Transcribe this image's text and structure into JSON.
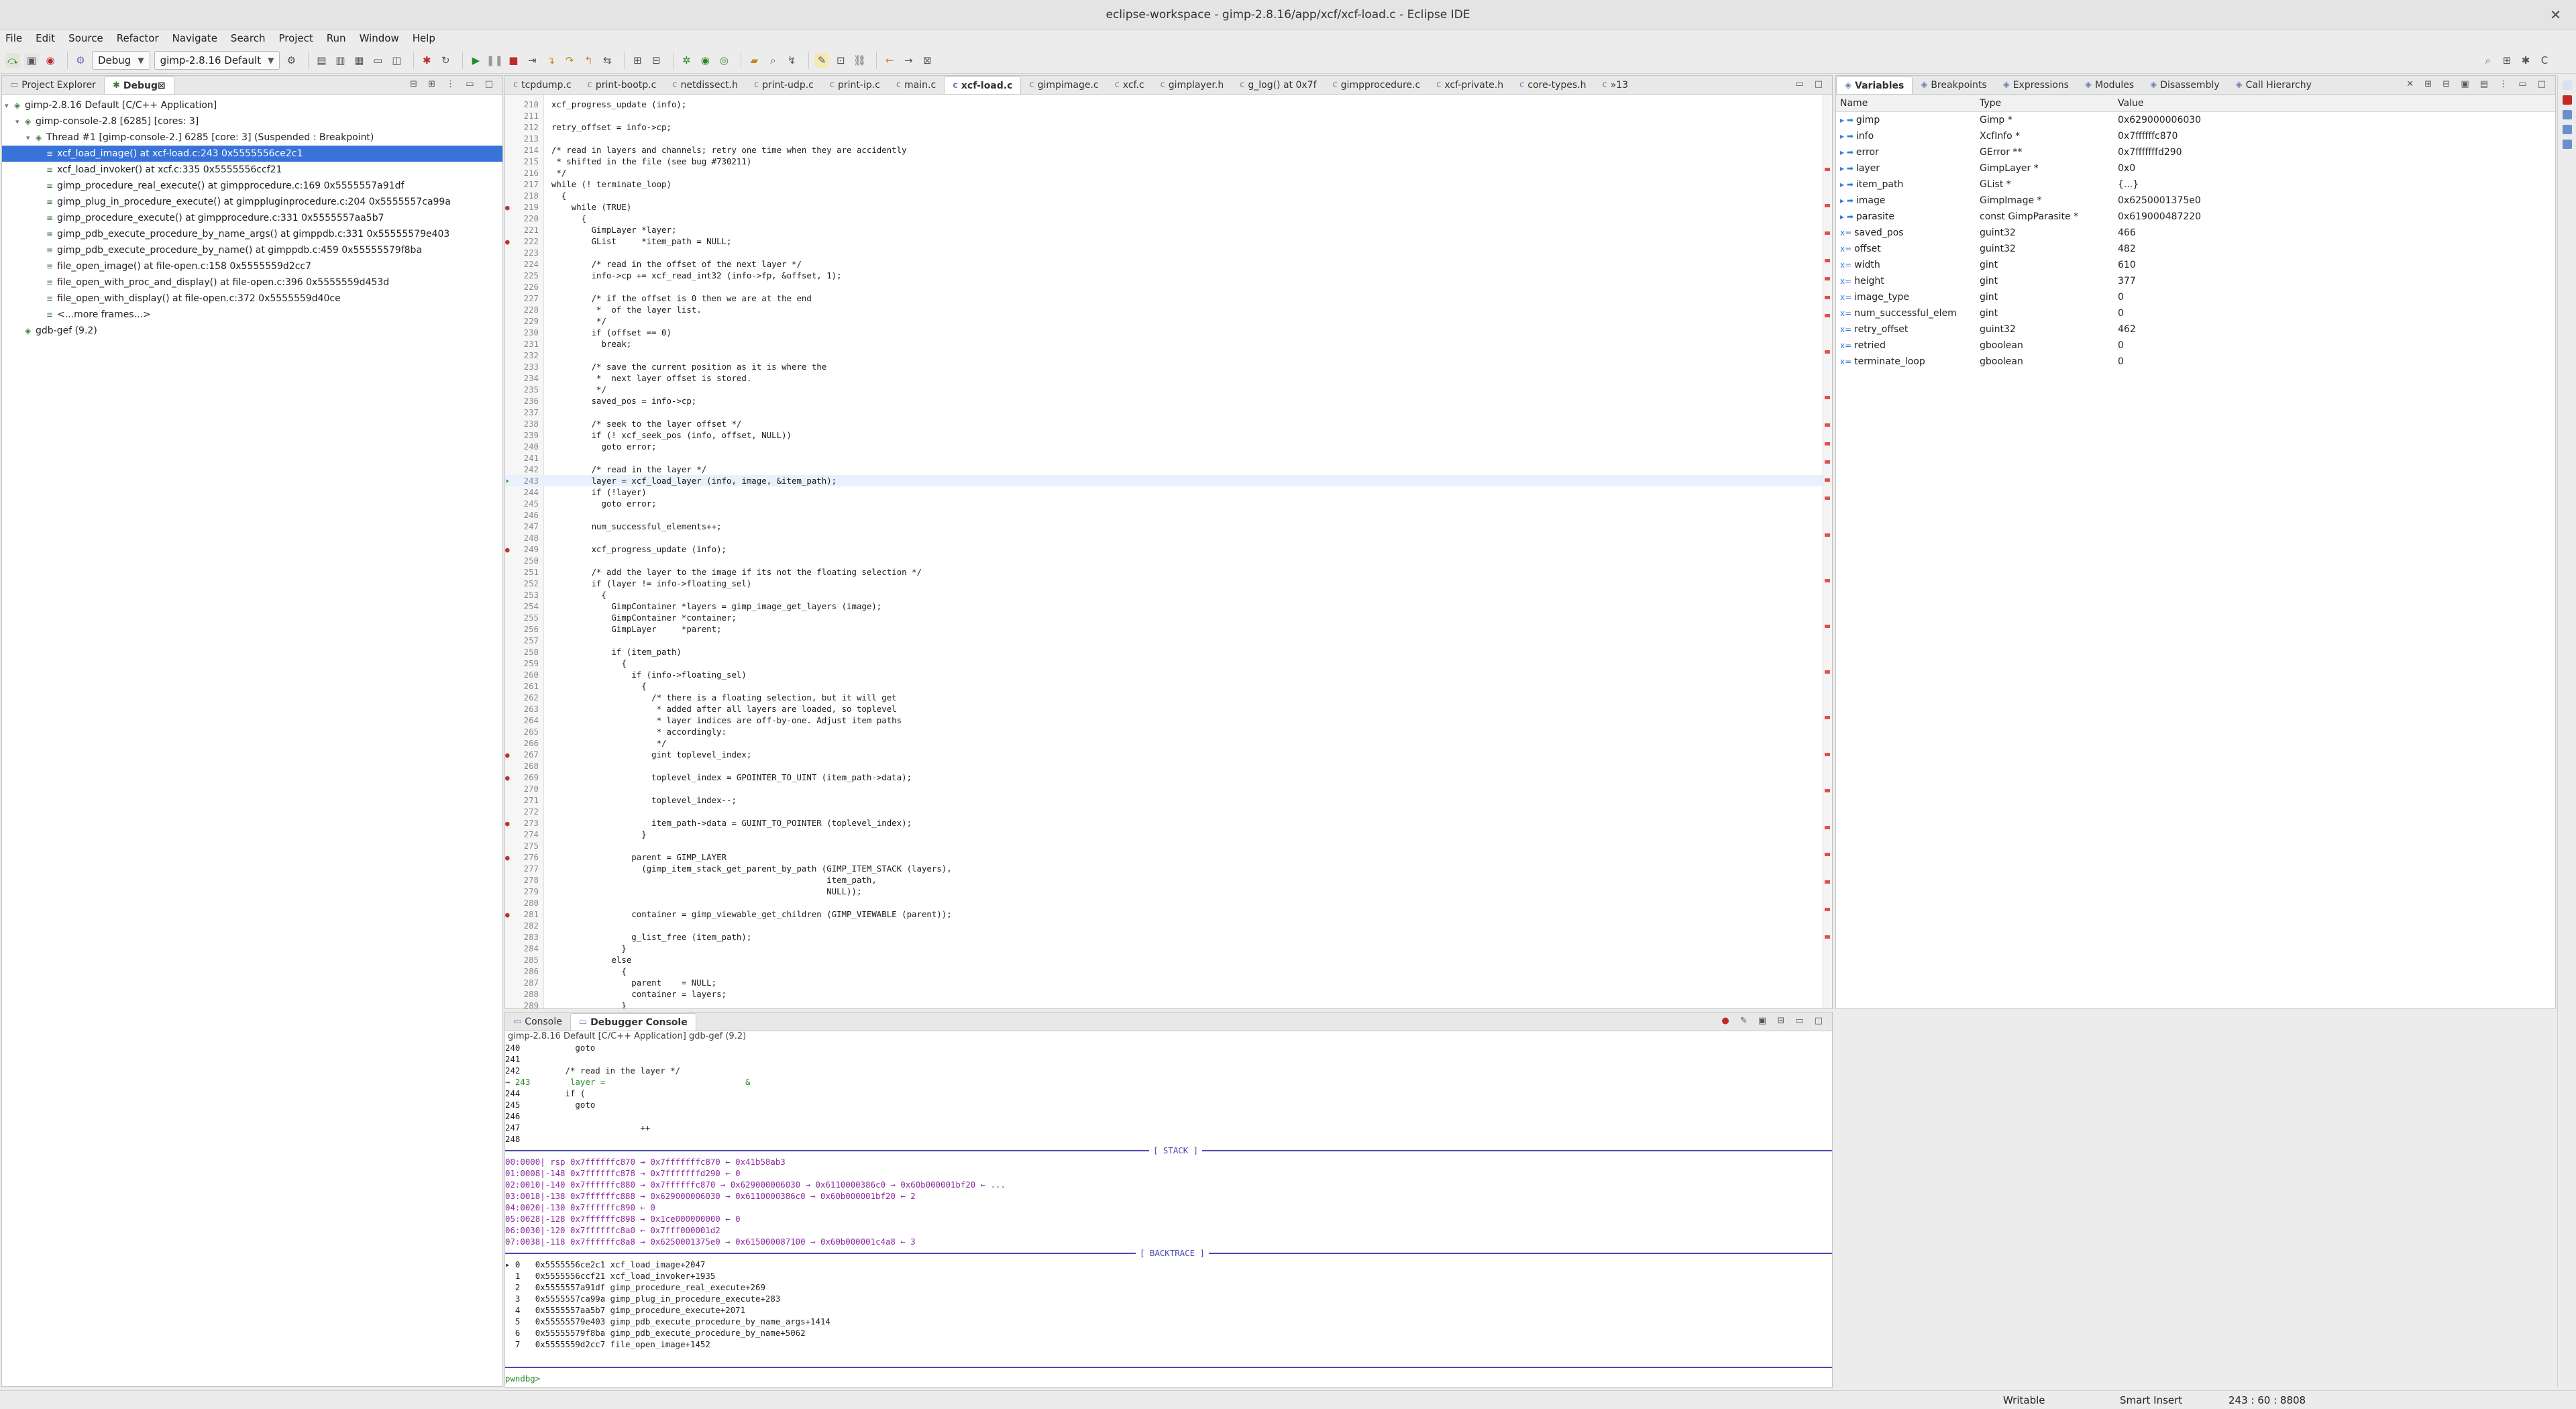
{
  "window": {
    "title": "eclipse-workspace - gimp-2.8.16/app/xcf/xcf-load.c - Eclipse IDE"
  },
  "menu": [
    "File",
    "Edit",
    "Source",
    "Refactor",
    "Navigate",
    "Search",
    "Project",
    "Run",
    "Window",
    "Help"
  ],
  "toolbar": {
    "perspective": "Debug",
    "launch_config": "gimp-2.8.16 Default"
  },
  "left_panel": {
    "tabs": [
      "Project Explorer",
      "Debug"
    ],
    "active_tab": "Debug",
    "tree": [
      {
        "indent": 0,
        "text": "gimp-2.8.16 Default [C/C++ Application]"
      },
      {
        "indent": 1,
        "text": "gimp-console-2.8 [6285] [cores: 3]"
      },
      {
        "indent": 2,
        "text": "Thread #1 [gimp-console-2.] 6285 [core: 3] (Suspended : Breakpoint)"
      },
      {
        "indent": 3,
        "text": "xcf_load_image() at xcf-load.c:243 0x5555556ce2c1",
        "selected": true
      },
      {
        "indent": 3,
        "text": "xcf_load_invoker() at xcf.c:335 0x5555556ccf21"
      },
      {
        "indent": 3,
        "text": "gimp_procedure_real_execute() at gimpprocedure.c:169 0x5555557a91df"
      },
      {
        "indent": 3,
        "text": "gimp_plug_in_procedure_execute() at gimppluginprocedure.c:204 0x5555557ca99a"
      },
      {
        "indent": 3,
        "text": "gimp_procedure_execute() at gimpprocedure.c:331 0x5555557aa5b7"
      },
      {
        "indent": 3,
        "text": "gimp_pdb_execute_procedure_by_name_args() at gimppdb.c:331 0x55555579e403"
      },
      {
        "indent": 3,
        "text": "gimp_pdb_execute_procedure_by_name() at gimppdb.c:459 0x55555579f8ba"
      },
      {
        "indent": 3,
        "text": "file_open_image() at file-open.c:158 0x5555559d2cc7"
      },
      {
        "indent": 3,
        "text": "file_open_with_proc_and_display() at file-open.c:396 0x5555559d453d"
      },
      {
        "indent": 3,
        "text": "file_open_with_display() at file-open.c:372 0x5555559d40ce"
      },
      {
        "indent": 3,
        "text": "<...more frames...>"
      },
      {
        "indent": 1,
        "text": "gdb-gef (9.2)"
      }
    ]
  },
  "editor": {
    "tabs": [
      "tcpdump.c",
      "print-bootp.c",
      "netdissect.h",
      "print-udp.c",
      "print-ip.c",
      "main.c",
      "xcf-load.c",
      "gimpimage.c",
      "xcf.c",
      "gimplayer.h",
      "g_log() at 0x7f",
      "gimpprocedure.c",
      "xcf-private.h",
      "core-types.h",
      "»13"
    ],
    "active_tab": "xcf-load.c",
    "lines": [
      {
        "n": "210",
        "t": "  xcf_progress_update (info);"
      },
      {
        "n": "211",
        "t": ""
      },
      {
        "n": "212",
        "t": "  retry_offset = info->cp;"
      },
      {
        "n": "213",
        "t": ""
      },
      {
        "n": "214",
        "t": "  /* read in layers and channels; retry one time when they are accidently"
      },
      {
        "n": "215",
        "t": "   * shifted in the file (see bug #730211)"
      },
      {
        "n": "216",
        "t": "   */"
      },
      {
        "n": "217",
        "t": "  while (! terminate_loop)"
      },
      {
        "n": "218",
        "t": "    {"
      },
      {
        "n": "219",
        "t": "      while (TRUE)"
      },
      {
        "n": "220",
        "t": "        {"
      },
      {
        "n": "221",
        "t": "          GimpLayer *layer;"
      },
      {
        "n": "222",
        "t": "          GList     *item_path = NULL;"
      },
      {
        "n": "223",
        "t": ""
      },
      {
        "n": "224",
        "t": "          /* read in the offset of the next layer */"
      },
      {
        "n": "225",
        "t": "          info->cp += xcf_read_int32 (info->fp, &offset, 1);"
      },
      {
        "n": "226",
        "t": ""
      },
      {
        "n": "227",
        "t": "          /* if the offset is 0 then we are at the end"
      },
      {
        "n": "228",
        "t": "           *  of the layer list."
      },
      {
        "n": "229",
        "t": "           */"
      },
      {
        "n": "230",
        "t": "          if (offset == 0)"
      },
      {
        "n": "231",
        "t": "            break;"
      },
      {
        "n": "232",
        "t": ""
      },
      {
        "n": "233",
        "t": "          /* save the current position as it is where the"
      },
      {
        "n": "234",
        "t": "           *  next layer offset is stored."
      },
      {
        "n": "235",
        "t": "           */"
      },
      {
        "n": "236",
        "t": "          saved_pos = info->cp;"
      },
      {
        "n": "237",
        "t": ""
      },
      {
        "n": "238",
        "t": "          /* seek to the layer offset */"
      },
      {
        "n": "239",
        "t": "          if (! xcf_seek_pos (info, offset, NULL))"
      },
      {
        "n": "240",
        "t": "            goto error;"
      },
      {
        "n": "241",
        "t": ""
      },
      {
        "n": "242",
        "t": "          /* read in the layer */"
      },
      {
        "n": "243",
        "t": "          layer = xcf_load_layer (info, image, &item_path);",
        "current": true
      },
      {
        "n": "244",
        "t": "          if (!layer)"
      },
      {
        "n": "245",
        "t": "            goto error;"
      },
      {
        "n": "246",
        "t": ""
      },
      {
        "n": "247",
        "t": "          num_successful_elements++;"
      },
      {
        "n": "248",
        "t": ""
      },
      {
        "n": "249",
        "t": "          xcf_progress_update (info);"
      },
      {
        "n": "250",
        "t": ""
      },
      {
        "n": "251",
        "t": "          /* add the layer to the image if its not the floating selection */"
      },
      {
        "n": "252",
        "t": "          if (layer != info->floating_sel)"
      },
      {
        "n": "253",
        "t": "            {"
      },
      {
        "n": "254",
        "t": "              GimpContainer *layers = gimp_image_get_layers (image);"
      },
      {
        "n": "255",
        "t": "              GimpContainer *container;"
      },
      {
        "n": "256",
        "t": "              GimpLayer     *parent;"
      },
      {
        "n": "257",
        "t": ""
      },
      {
        "n": "258",
        "t": "              if (item_path)"
      },
      {
        "n": "259",
        "t": "                {"
      },
      {
        "n": "260",
        "t": "                  if (info->floating_sel)"
      },
      {
        "n": "261",
        "t": "                    {"
      },
      {
        "n": "262",
        "t": "                      /* there is a floating selection, but it will get"
      },
      {
        "n": "263",
        "t": "                       * added after all layers are loaded, so toplevel"
      },
      {
        "n": "264",
        "t": "                       * layer indices are off-by-one. Adjust item paths"
      },
      {
        "n": "265",
        "t": "                       * accordingly:"
      },
      {
        "n": "266",
        "t": "                       */"
      },
      {
        "n": "267",
        "t": "                      gint toplevel_index;"
      },
      {
        "n": "268",
        "t": ""
      },
      {
        "n": "269",
        "t": "                      toplevel_index = GPOINTER_TO_UINT (item_path->data);"
      },
      {
        "n": "270",
        "t": ""
      },
      {
        "n": "271",
        "t": "                      toplevel_index--;"
      },
      {
        "n": "272",
        "t": ""
      },
      {
        "n": "273",
        "t": "                      item_path->data = GUINT_TO_POINTER (toplevel_index);"
      },
      {
        "n": "274",
        "t": "                    }"
      },
      {
        "n": "275",
        "t": ""
      },
      {
        "n": "276",
        "t": "                  parent = GIMP_LAYER"
      },
      {
        "n": "277",
        "t": "                    (gimp_item_stack_get_parent_by_path (GIMP_ITEM_STACK (layers),"
      },
      {
        "n": "278",
        "t": "                                                         item_path,"
      },
      {
        "n": "279",
        "t": "                                                         NULL));"
      },
      {
        "n": "280",
        "t": ""
      },
      {
        "n": "281",
        "t": "                  container = gimp_viewable_get_children (GIMP_VIEWABLE (parent));"
      },
      {
        "n": "282",
        "t": ""
      },
      {
        "n": "283",
        "t": "                  g_list_free (item_path);"
      },
      {
        "n": "284",
        "t": "                }"
      },
      {
        "n": "285",
        "t": "              else"
      },
      {
        "n": "286",
        "t": "                {"
      },
      {
        "n": "287",
        "t": "                  parent    = NULL;"
      },
      {
        "n": "288",
        "t": "                  container = layers;"
      },
      {
        "n": "289",
        "t": "                }"
      },
      {
        "n": "290",
        "t": ""
      }
    ]
  },
  "variables": {
    "tabs": [
      "Variables",
      "Breakpoints",
      "Expressions",
      "Modules",
      "Disassembly",
      "Call Hierarchy"
    ],
    "active_tab": "Variables",
    "columns": [
      "Name",
      "Type",
      "Value"
    ],
    "rows": [
      {
        "name": "gimp",
        "type": "Gimp *",
        "value": "0x629000006030"
      },
      {
        "name": "info",
        "type": "XcfInfo *",
        "value": "0x7ffffffc870"
      },
      {
        "name": "error",
        "type": "GError **",
        "value": "0x7fffffffd290"
      },
      {
        "name": "layer",
        "type": "GimpLayer *",
        "value": "0x0"
      },
      {
        "name": "item_path",
        "type": "GList *",
        "value": "{...}"
      },
      {
        "name": "image",
        "type": "GimpImage *",
        "value": "0x6250001375e0"
      },
      {
        "name": "parasite",
        "type": "const GimpParasite *",
        "value": "0x619000487220"
      },
      {
        "name": "saved_pos",
        "type": "guint32",
        "value": "466"
      },
      {
        "name": "offset",
        "type": "guint32",
        "value": "482"
      },
      {
        "name": "width",
        "type": "gint",
        "value": "610"
      },
      {
        "name": "height",
        "type": "gint",
        "value": "377"
      },
      {
        "name": "image_type",
        "type": "gint",
        "value": "0"
      },
      {
        "name": "num_successful_elem",
        "type": "gint",
        "value": "0"
      },
      {
        "name": "retry_offset",
        "type": "guint32",
        "value": "462"
      },
      {
        "name": "retried",
        "type": "gboolean",
        "value": "0"
      },
      {
        "name": "terminate_loop",
        "type": "gboolean",
        "value": "0"
      }
    ]
  },
  "console": {
    "tabs": [
      "Console",
      "Debugger Console"
    ],
    "active_tab": "Debugger Console",
    "header": "gimp-2.8.16 Default [C/C++ Application] gdb-gef (9.2)",
    "source_lines": [
      "240           goto",
      "241",
      "242         /* read in the layer */",
      "→ 243        layer =                            &",
      "244         if (",
      "245           goto",
      "246",
      "247                        ++",
      "248"
    ],
    "stack_label": "[ STACK ]",
    "stack": [
      "00:0000| rsp 0x7ffffffc870 → 0x7fffffffc870 ← 0x41b58ab3",
      "01:0008|-148 0x7ffffffc878 → 0x7fffffffd290 ← 0",
      "02:0010|-140 0x7ffffffc880 → 0x7ffffffc870 → 0x629000006030 → 0x6110000386c0 → 0x60b000001bf20 ← ...",
      "03:0018|-138 0x7ffffffc888 → 0x629000006030 → 0x6110000386c0 → 0x60b000001bf20 ← 2",
      "04:0020|-130 0x7ffffffc890 ← 0",
      "05:0028|-128 0x7ffffffc898 → 0x1ce000000000 ← 0",
      "06:0030|-120 0x7ffffffc8a0 ← 0x7fff000001d2",
      "07:0038|-118 0x7ffffffc8a8 → 0x6250001375e0 → 0x615000087100 → 0x60b000001c4a8 ← 3"
    ],
    "backtrace_label": "[ BACKTRACE ]",
    "backtrace": [
      "▸ 0   0x5555556ce2c1 xcf_load_image+2047",
      "  1   0x5555556ccf21 xcf_load_invoker+1935",
      "  2   0x5555557a91df gimp_procedure_real_execute+269",
      "  3   0x5555557ca99a gimp_plug_in_procedure_execute+283",
      "  4   0x5555557aa5b7 gimp_procedure_execute+2071",
      "  5   0x55555579e403 gimp_pdb_execute_procedure_by_name_args+1414",
      "  6   0x55555579f8ba gimp_pdb_execute_procedure_by_name+5062",
      "  7   0x5555559d2cc7 file_open_image+1452"
    ],
    "prompt": "pwndbg>"
  },
  "statusbar": {
    "mode": "Writable",
    "insert": "Smart Insert",
    "position": "243 : 60 : 8808"
  },
  "colors": {
    "selection": "#3873d8",
    "current_line": "#e8f2fe",
    "ruler_mark": "#e05050",
    "accent": "#4a4ab0"
  }
}
